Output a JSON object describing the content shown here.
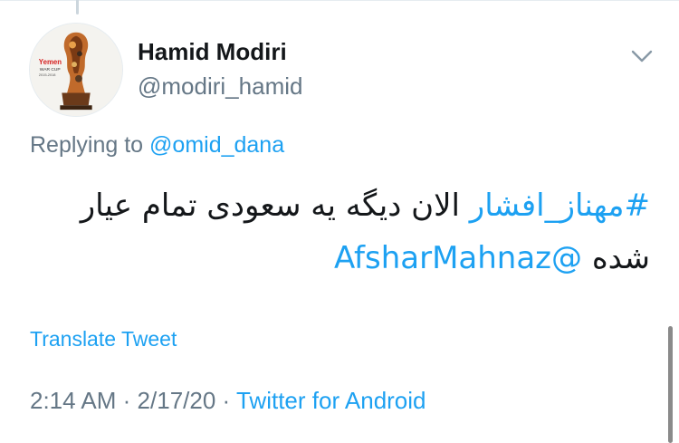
{
  "tweet": {
    "author_name": "Hamid Modiri",
    "author_handle": "@modiri_hamid",
    "avatar_logo_text": "Yemen WAR CUP 2015-2018",
    "replying_label": "Replying to",
    "replying_to": "@omid_dana",
    "hashtag": "#مهناز_افشار",
    "text_main": "الان دیگه یه سعودی تمام عیار شده",
    "mention": "@AfsharMahnaz",
    "translate_label": "Translate Tweet",
    "time": "2:14 AM",
    "separator": "·",
    "date": "2/17/20",
    "source": "Twitter for Android"
  },
  "icons": {
    "menu_caret": "chevron-down-icon"
  },
  "colors": {
    "link": "#1da1f2",
    "secondary_text": "#657786",
    "primary_text": "#14171a"
  }
}
